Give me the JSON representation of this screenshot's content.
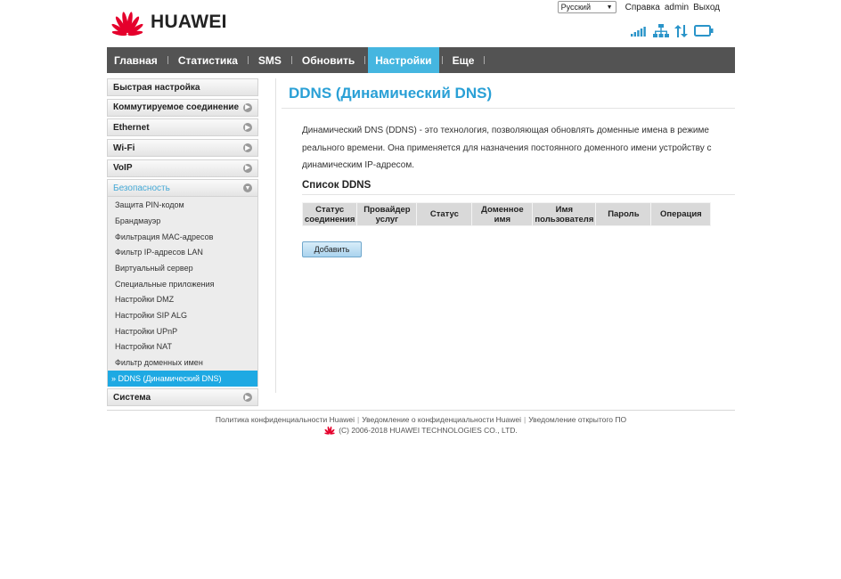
{
  "brand": {
    "name": "HUAWEI",
    "color": "#e5002c"
  },
  "toplinks": {
    "language": "Русский",
    "help": "Справка",
    "user": "admin",
    "logout": "Выход"
  },
  "status_icons": [
    "signal-strength-icon",
    "network-icon",
    "data-transfer-icon",
    "display-icon"
  ],
  "nav": {
    "items": [
      {
        "label": "Главная",
        "active": false
      },
      {
        "label": "Статистика",
        "active": false
      },
      {
        "label": "SMS",
        "active": false
      },
      {
        "label": "Обновить",
        "active": false
      },
      {
        "label": "Настройки",
        "active": true
      },
      {
        "label": "Еще",
        "active": false
      }
    ],
    "accent": "#45b6e0"
  },
  "sidebar": {
    "quick_setup": "Быстрая настройка",
    "dialup": "Коммутируемое соединение",
    "ethernet": "Ethernet",
    "wifi": "Wi-Fi",
    "voip": "VoIP",
    "security": "Безопасность",
    "system": "Система",
    "security_items": [
      "Защита PIN-кодом",
      "Брандмауэр",
      "Фильтрация MAC-адресов",
      "Фильтр IP-адресов LAN",
      "Виртуальный сервер",
      "Специальные приложения",
      "Настройки DMZ",
      "Настройки SIP ALG",
      "Настройки UPnP",
      "Настройки NAT",
      "Фильтр доменных имен",
      "DDNS (Динамический DNS)"
    ],
    "active_item": "DDNS (Динамический DNS)"
  },
  "main": {
    "title": "DDNS (Динамический DNS)",
    "description": "Динамический DNS (DDNS) - это технология, позволяющая обновлять доменные имена в режиме реального времени. Она применяется для назначения постоянного доменного имени устройству с динамическим IP-адресом.",
    "list_title": "Список DDNS",
    "table_headers": [
      "Статус соединения",
      "Провайдер услуг",
      "Статус",
      "Доменное имя",
      "Имя пользователя",
      "Пароль",
      "Операция"
    ],
    "add_button": "Добавить"
  },
  "footer": {
    "links": [
      "Политика конфиденциальности Huawei",
      "Уведомление о конфиденциальности Huawei",
      "Уведомление открытого ПО"
    ],
    "copyright": "(C) 2006-2018 HUAWEI TECHNOLOGIES CO., LTD."
  }
}
